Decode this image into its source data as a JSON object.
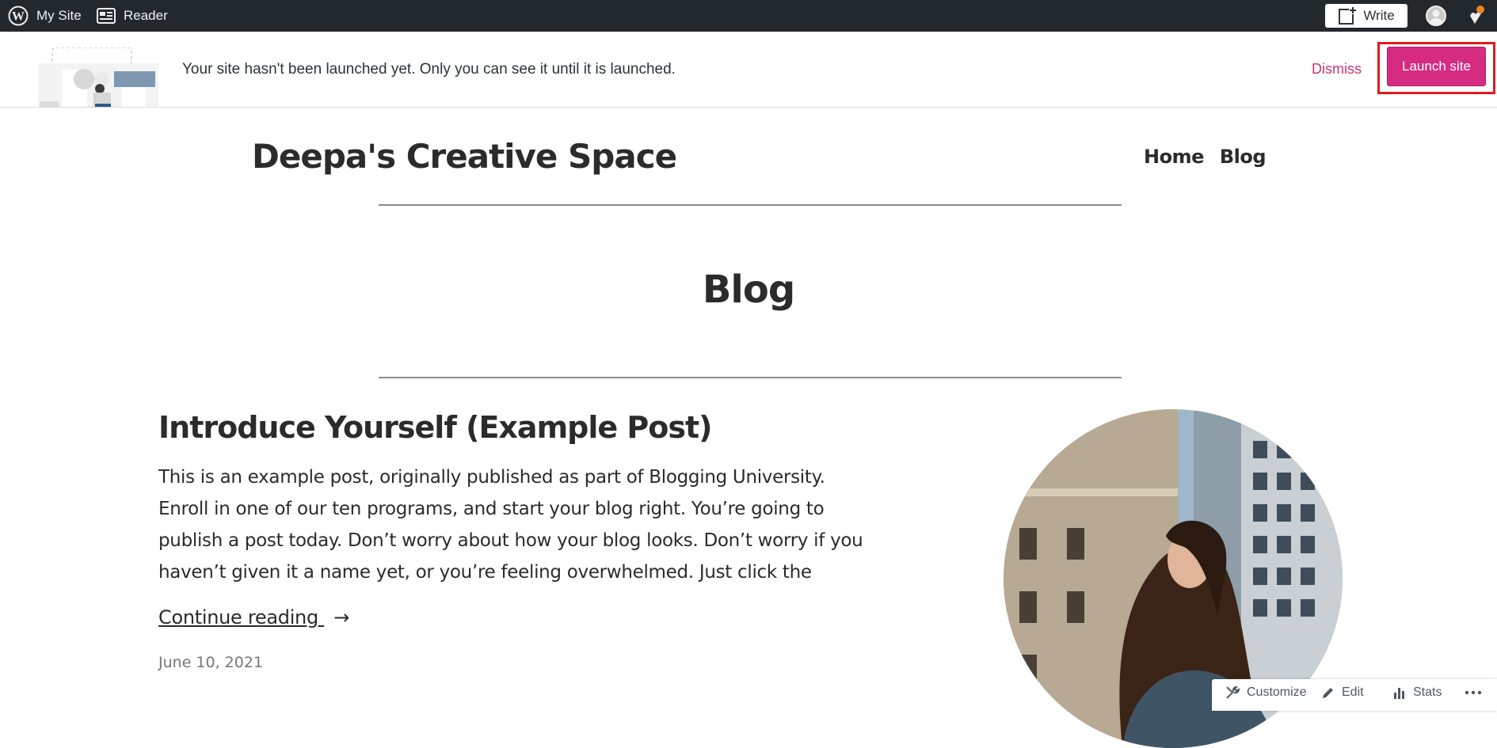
{
  "adminbar": {
    "my_site": "My Site",
    "reader": "Reader",
    "write": "Write"
  },
  "banner": {
    "message": "Your site hasn't been launched yet. Only you can see it until it is launched.",
    "dismiss": "Dismiss",
    "launch": "Launch site"
  },
  "site": {
    "title": "Deepa's Creative Space",
    "nav": [
      "Home",
      "Blog"
    ]
  },
  "page": {
    "title": "Blog"
  },
  "post": {
    "title": "Introduce Yourself (Example Post)",
    "excerpt": "This is an example post, originally published as part of Blogging University. Enroll in one of our ten programs, and start your blog right. You’re going to publish a post today. Don’t worry about how your blog looks. Don’t worry if you haven’t given it a name yet, or you’re feeling overwhelmed. Just click the",
    "continue": "Continue reading ",
    "arrow": "→",
    "date": "June 10, 2021"
  },
  "actionbar": {
    "customize": "Customize",
    "edit": "Edit",
    "stats": "Stats"
  },
  "colors": {
    "admin_bar": "#23282d",
    "launch_button": "#d52c82",
    "dismiss_link": "#c9356e",
    "highlight_outline": "#e21a1a"
  }
}
